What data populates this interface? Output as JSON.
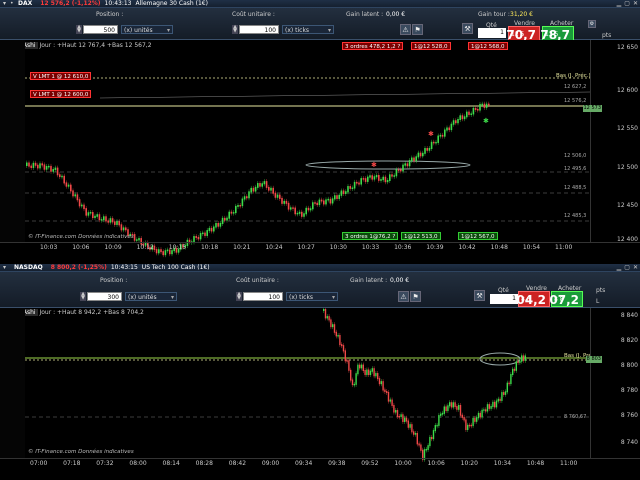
{
  "top": {
    "title": {
      "symbol": "DAX",
      "price_change": "12 576,2 (-1,12%)",
      "time": "10:43:13",
      "instrument": "Allemagne 30 Cash (1€)"
    },
    "order": {
      "position_label": "Position :",
      "cost_label": "Coût unitaire :",
      "pnl_label": "Gain latent :",
      "pnl_value": "0,00 €",
      "gain_label": "Gain tour :",
      "gain_value": "31,20 €",
      "qty_value": "500",
      "qty_unit": "(x) unités",
      "ticks_value": "100",
      "ticks_unit": "(x) ticks",
      "qte_label": "Qté",
      "qte_value": "1",
      "sell_label": "Vendre",
      "buy_label": "Acheter",
      "sell_small": "12 5",
      "sell_big": "70,7",
      "buy_small": "12 5",
      "buy_big": "78,7",
      "pts_label": "pts"
    },
    "chart": {
      "indicator": "Heikin-Ashi",
      "info": "Jour : +Haut 12 767,4 +Bas 12 567,2",
      "tags": [
        "3 ordres 478,2 1,2 ?",
        "1@12 528,0",
        "1@12 568,0",
        "3 ordres 1@76,2 ?",
        "1@12 513,0",
        "1@12 567,0"
      ],
      "left_orders": [
        "V LMT 1 @ 12 610,0",
        "V LMT 1 @ 12 600,0"
      ],
      "bas_label": "Bas (J. Préc.)",
      "yticks": [
        "12 650",
        "12 600",
        "12 550",
        "12 500",
        "12 450",
        "12 400"
      ],
      "side_prices": [
        "12 627,2",
        "12 576,2",
        "12 495,6",
        "12 488,5",
        "12 485,3",
        "12 506,0"
      ],
      "price_current": "12 573",
      "xticks": [
        "10:03",
        "10:06",
        "10:09",
        "10:12",
        "10:15",
        "10:18",
        "10:21",
        "10:24",
        "10:27",
        "10:30",
        "10:33",
        "10:36",
        "10:39",
        "10:42",
        "10:48",
        "10:54",
        "11:00"
      ],
      "credit": "© IT-Finance.com Données indicatives"
    }
  },
  "bottom": {
    "title": {
      "symbol": "NASDAQ",
      "price_change": "8 800,2 (-1,25%)",
      "time": "10:43:15",
      "instrument": "US Tech 100 Cash (1€)"
    },
    "order": {
      "position_label": "Position :",
      "cost_label": "Coût unitaire :",
      "pnl_label": "Gain latent :",
      "pnl_value": "0,00 €",
      "qty_value": "300",
      "qty_unit": "(x) unités",
      "ticks_value": "100",
      "ticks_unit": "(x) ticks",
      "qte_label": "Qté",
      "qte_value": "1",
      "sell_label": "Vendre",
      "buy_label": "Acheter",
      "sell_small": "8 8",
      "sell_big": "04,2",
      "buy_small": "8 8",
      "buy_big": "07,2",
      "pts_label": "pts",
      "l_label": "L"
    },
    "chart": {
      "indicator": "Heikin-Ashi",
      "info": "Jour : +Haut 8 942,2 +Bas 8 704,2",
      "bas_label": "Bas (J. Préc.)",
      "yticks": [
        "8 840",
        "8 820",
        "8 800",
        "8 780",
        "8 760",
        "8 740"
      ],
      "side_prices": [
        "8 760,67"
      ],
      "price_current": "8 803",
      "xticks": [
        "07:00",
        "07:18",
        "07:32",
        "08:00",
        "08:14",
        "08:28",
        "08:42",
        "09:00",
        "09:34",
        "09:38",
        "09:52",
        "10:00",
        "10:06",
        "10:20",
        "10:34",
        "10:48",
        "11:00"
      ],
      "credit": "© IT-Finance.com Données indicatives"
    }
  },
  "colors": {
    "bull": "#3ddc4a",
    "bear": "#f04848",
    "bg": "#000000",
    "accent": "#e8e8a0"
  }
}
